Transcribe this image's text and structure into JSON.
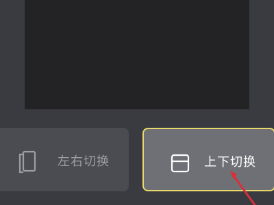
{
  "layout_options": [
    {
      "label": "左右切换",
      "icon": "split-left-right-icon",
      "selected": false
    },
    {
      "label": "上下切换",
      "icon": "split-top-bottom-icon",
      "selected": true
    }
  ],
  "colors": {
    "background": "#393b40",
    "preview": "#232325",
    "selected_border": "#e8d96a",
    "arrow": "#d8303a"
  }
}
